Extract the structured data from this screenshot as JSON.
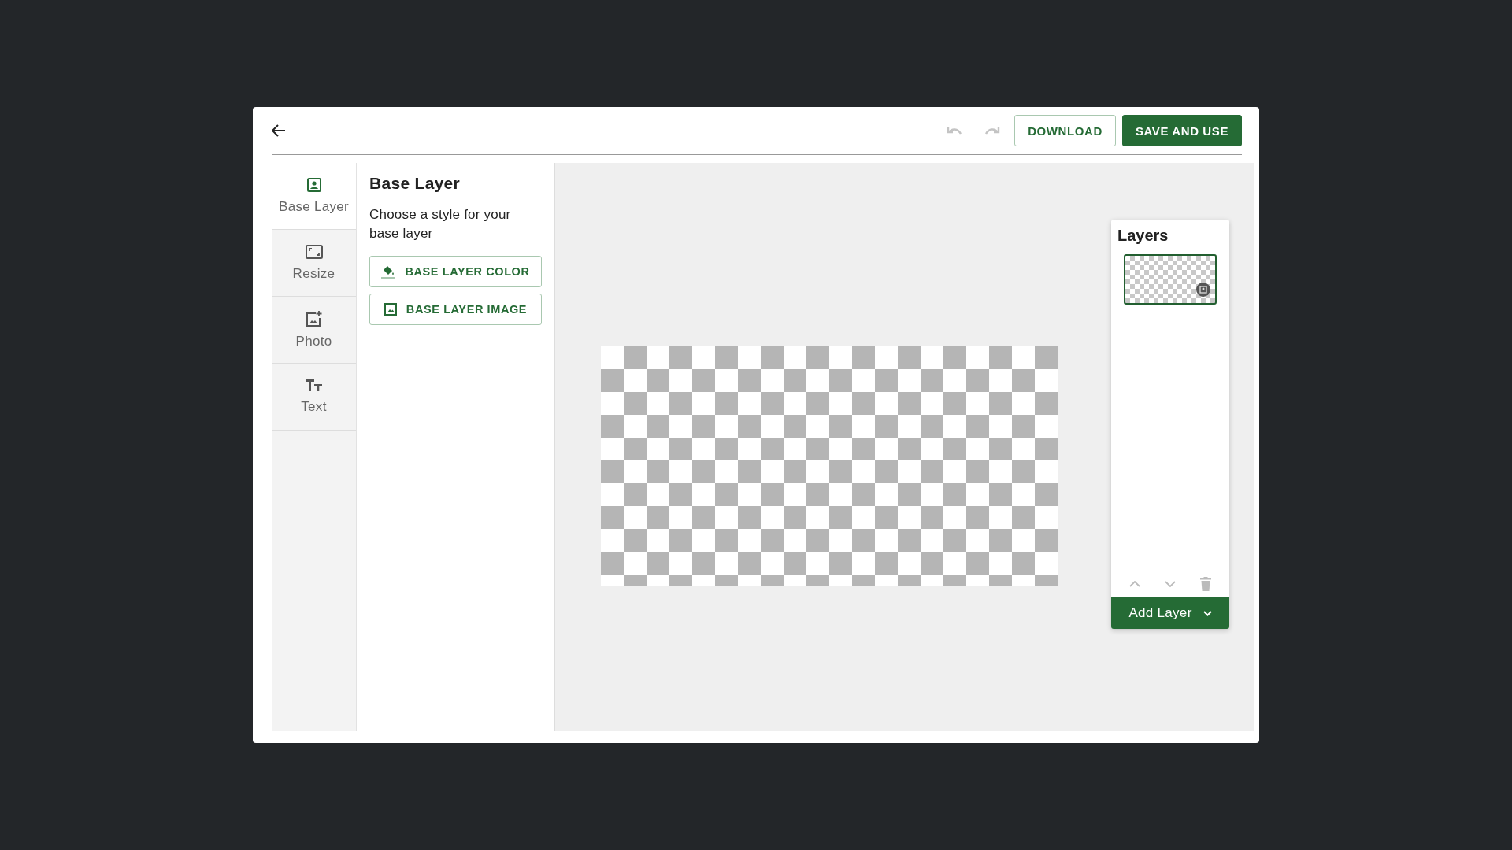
{
  "toolbar": {
    "undo_disabled": true,
    "redo_disabled": true,
    "buttons": [
      {
        "label": "DOWNLOAD",
        "kind": "outline"
      },
      {
        "label": "SAVE AND USE",
        "kind": "primary"
      }
    ]
  },
  "sidebar": {
    "items": [
      {
        "label": "Base Layer",
        "kind": "base",
        "selected": true
      },
      {
        "label": "Resize",
        "kind": "resize",
        "selected": false
      },
      {
        "label": "Photo",
        "kind": "photo",
        "selected": false
      },
      {
        "label": "Text",
        "kind": "text",
        "selected": false
      }
    ]
  },
  "panel": {
    "title": "Base Layer",
    "description": "Choose a style for your base layer",
    "buttons": [
      {
        "label": "BASE LAYER COLOR",
        "kind": "color"
      },
      {
        "label": "BASE LAYER IMAGE",
        "kind": "image"
      }
    ]
  },
  "layers": {
    "title": "Layers",
    "items": [
      {
        "selected": true
      }
    ],
    "add_button": "Add Layer"
  }
}
